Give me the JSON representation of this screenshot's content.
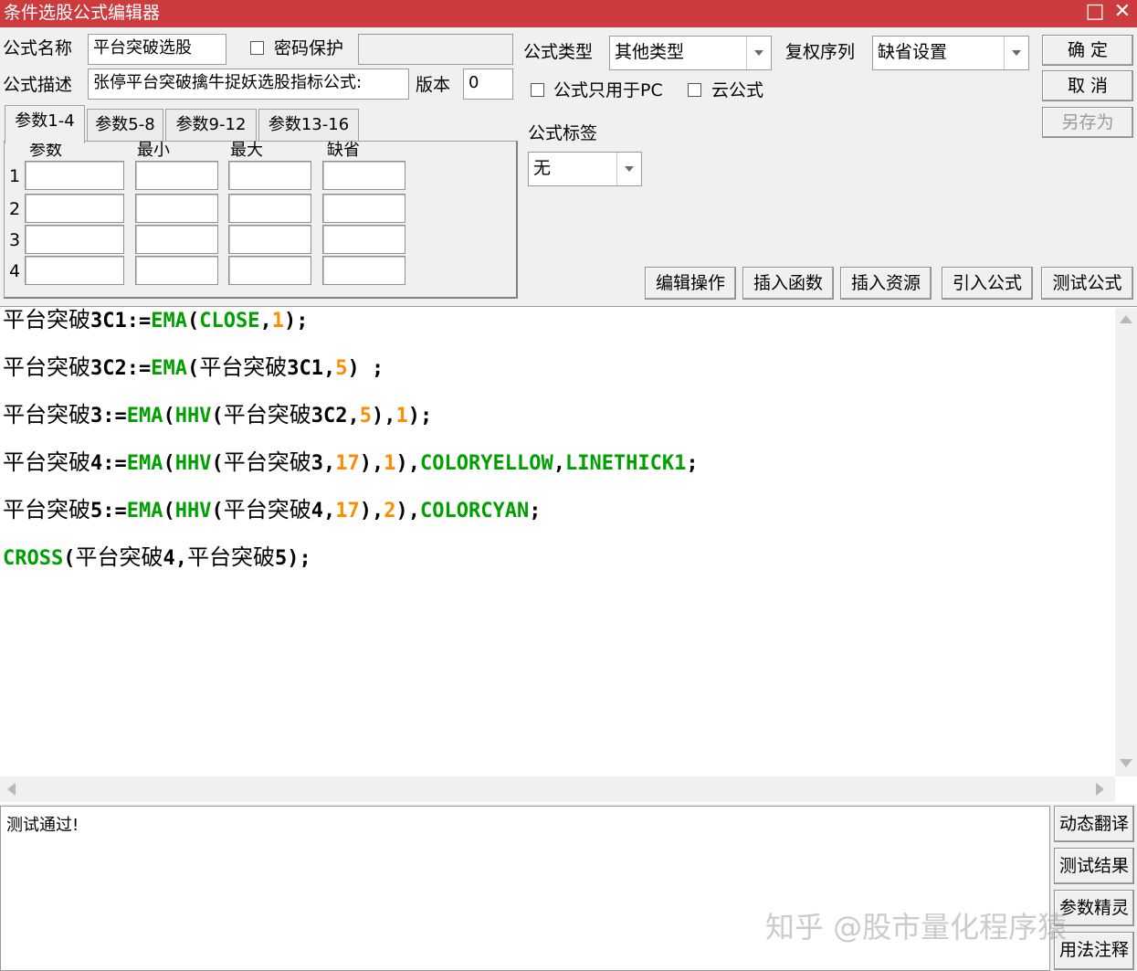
{
  "window": {
    "title": "条件选股公式编辑器",
    "maximize": "□",
    "close": "✕"
  },
  "form": {
    "name_label": "公式名称",
    "name_value": "平台突破选股",
    "password_label": "密码保护",
    "desc_label": "公式描述",
    "desc_value": "张停平台突破擒牛捉妖选股指标公式:",
    "version_label": "版本",
    "version_value": "0",
    "type_label": "公式类型",
    "type_value": "其他类型",
    "rights_label": "复权序列",
    "rights_value": "缺省设置",
    "pc_only_label": "公式只用于PC",
    "cloud_label": "云公式",
    "tag_label": "公式标签",
    "tag_value": "无"
  },
  "buttons": {
    "ok": "确 定",
    "cancel": "取 消",
    "save_as": "另存为"
  },
  "tabs": [
    "参数1-4",
    "参数5-8",
    "参数9-12",
    "参数13-16"
  ],
  "params": {
    "headers": [
      "参数",
      "最小",
      "最大",
      "缺省"
    ],
    "rows": [
      "1",
      "2",
      "3",
      "4"
    ]
  },
  "toolbar": [
    "编辑操作",
    "插入函数",
    "插入资源",
    "引入公式",
    "测试公式"
  ],
  "code": {
    "lines": [
      [
        [
          "cn",
          "平台突破"
        ],
        [
          "plain",
          "3C1:="
        ],
        [
          "kw",
          "EMA"
        ],
        [
          "plain",
          "("
        ],
        [
          "kw",
          "CLOSE"
        ],
        [
          "plain",
          ","
        ],
        [
          "num",
          "1"
        ],
        [
          "plain",
          ");"
        ]
      ],
      [
        [
          "cn",
          "平台突破"
        ],
        [
          "plain",
          "3C2:="
        ],
        [
          "kw",
          "EMA"
        ],
        [
          "plain",
          "("
        ],
        [
          "cn",
          "平台突破"
        ],
        [
          "plain",
          "3C1,"
        ],
        [
          "num",
          "5"
        ],
        [
          "plain",
          ") ;"
        ]
      ],
      [
        [
          "cn",
          "平台突破"
        ],
        [
          "plain",
          "3:="
        ],
        [
          "kw",
          "EMA"
        ],
        [
          "plain",
          "("
        ],
        [
          "kw",
          "HHV"
        ],
        [
          "plain",
          "("
        ],
        [
          "cn",
          "平台突破"
        ],
        [
          "plain",
          "3C2,"
        ],
        [
          "num",
          "5"
        ],
        [
          "plain",
          "),"
        ],
        [
          "num",
          "1"
        ],
        [
          "plain",
          ");"
        ]
      ],
      [
        [
          "cn",
          "平台突破"
        ],
        [
          "plain",
          "4:="
        ],
        [
          "kw",
          "EMA"
        ],
        [
          "plain",
          "("
        ],
        [
          "kw",
          "HHV"
        ],
        [
          "plain",
          "("
        ],
        [
          "cn",
          "平台突破"
        ],
        [
          "plain",
          "3,"
        ],
        [
          "num",
          "17"
        ],
        [
          "plain",
          "),"
        ],
        [
          "num",
          "1"
        ],
        [
          "plain",
          "),"
        ],
        [
          "kw",
          "COLORYELLOW"
        ],
        [
          "plain",
          ","
        ],
        [
          "kw",
          "LINETHICK1"
        ],
        [
          "plain",
          ";"
        ]
      ],
      [
        [
          "cn",
          "平台突破"
        ],
        [
          "plain",
          "5:="
        ],
        [
          "kw",
          "EMA"
        ],
        [
          "plain",
          "("
        ],
        [
          "kw",
          "HHV"
        ],
        [
          "plain",
          "("
        ],
        [
          "cn",
          "平台突破"
        ],
        [
          "plain",
          "4,"
        ],
        [
          "num",
          "17"
        ],
        [
          "plain",
          "),"
        ],
        [
          "num",
          "2"
        ],
        [
          "plain",
          "),"
        ],
        [
          "kw",
          "COLORCYAN"
        ],
        [
          "plain",
          ";"
        ]
      ],
      [
        [
          "kw",
          "CROSS"
        ],
        [
          "plain",
          "("
        ],
        [
          "cn",
          "平台突破"
        ],
        [
          "plain",
          "4,"
        ],
        [
          "cn",
          "平台突破"
        ],
        [
          "plain",
          "5);"
        ]
      ]
    ]
  },
  "result": {
    "text": "测试通过!"
  },
  "side_buttons": [
    "动态翻译",
    "测试结果",
    "参数精灵",
    "用法注释"
  ],
  "watermark": "知乎 @股市量化程序猿",
  "colors": {
    "title_bar": "#cc3b3d",
    "keyword": "#00a000",
    "number": "#ff8c00"
  }
}
